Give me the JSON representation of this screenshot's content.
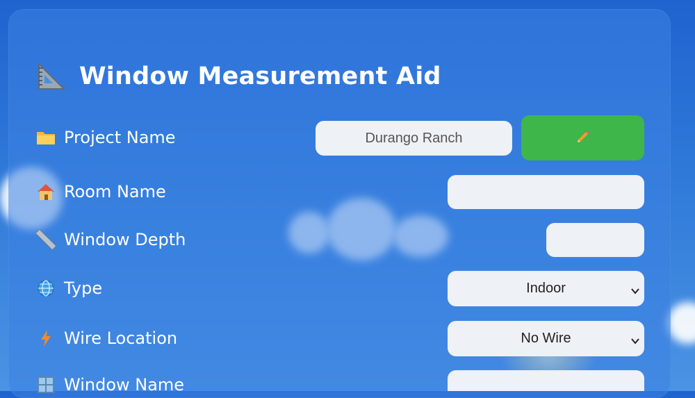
{
  "title": "Window Measurement Aid",
  "rows": {
    "project": {
      "label": "Project Name",
      "value": "Durango Ranch"
    },
    "room": {
      "label": "Room Name",
      "value": ""
    },
    "depth": {
      "label": "Window Depth",
      "value": ""
    },
    "type": {
      "label": "Type",
      "selected": "Indoor"
    },
    "wire": {
      "label": "Wire Location",
      "selected": "No Wire"
    },
    "window": {
      "label": "Window Name",
      "value": ""
    }
  },
  "icons": {
    "title": "triangle-ruler-icon",
    "project": "folder-icon",
    "room": "house-icon",
    "depth": "ruler-icon",
    "type": "globe-icon",
    "wire": "lightning-icon",
    "window": "window-icon",
    "edit": "pencil-icon"
  },
  "colors": {
    "edit_button": "#3eb64a",
    "field_bg": "#eef1f6"
  }
}
